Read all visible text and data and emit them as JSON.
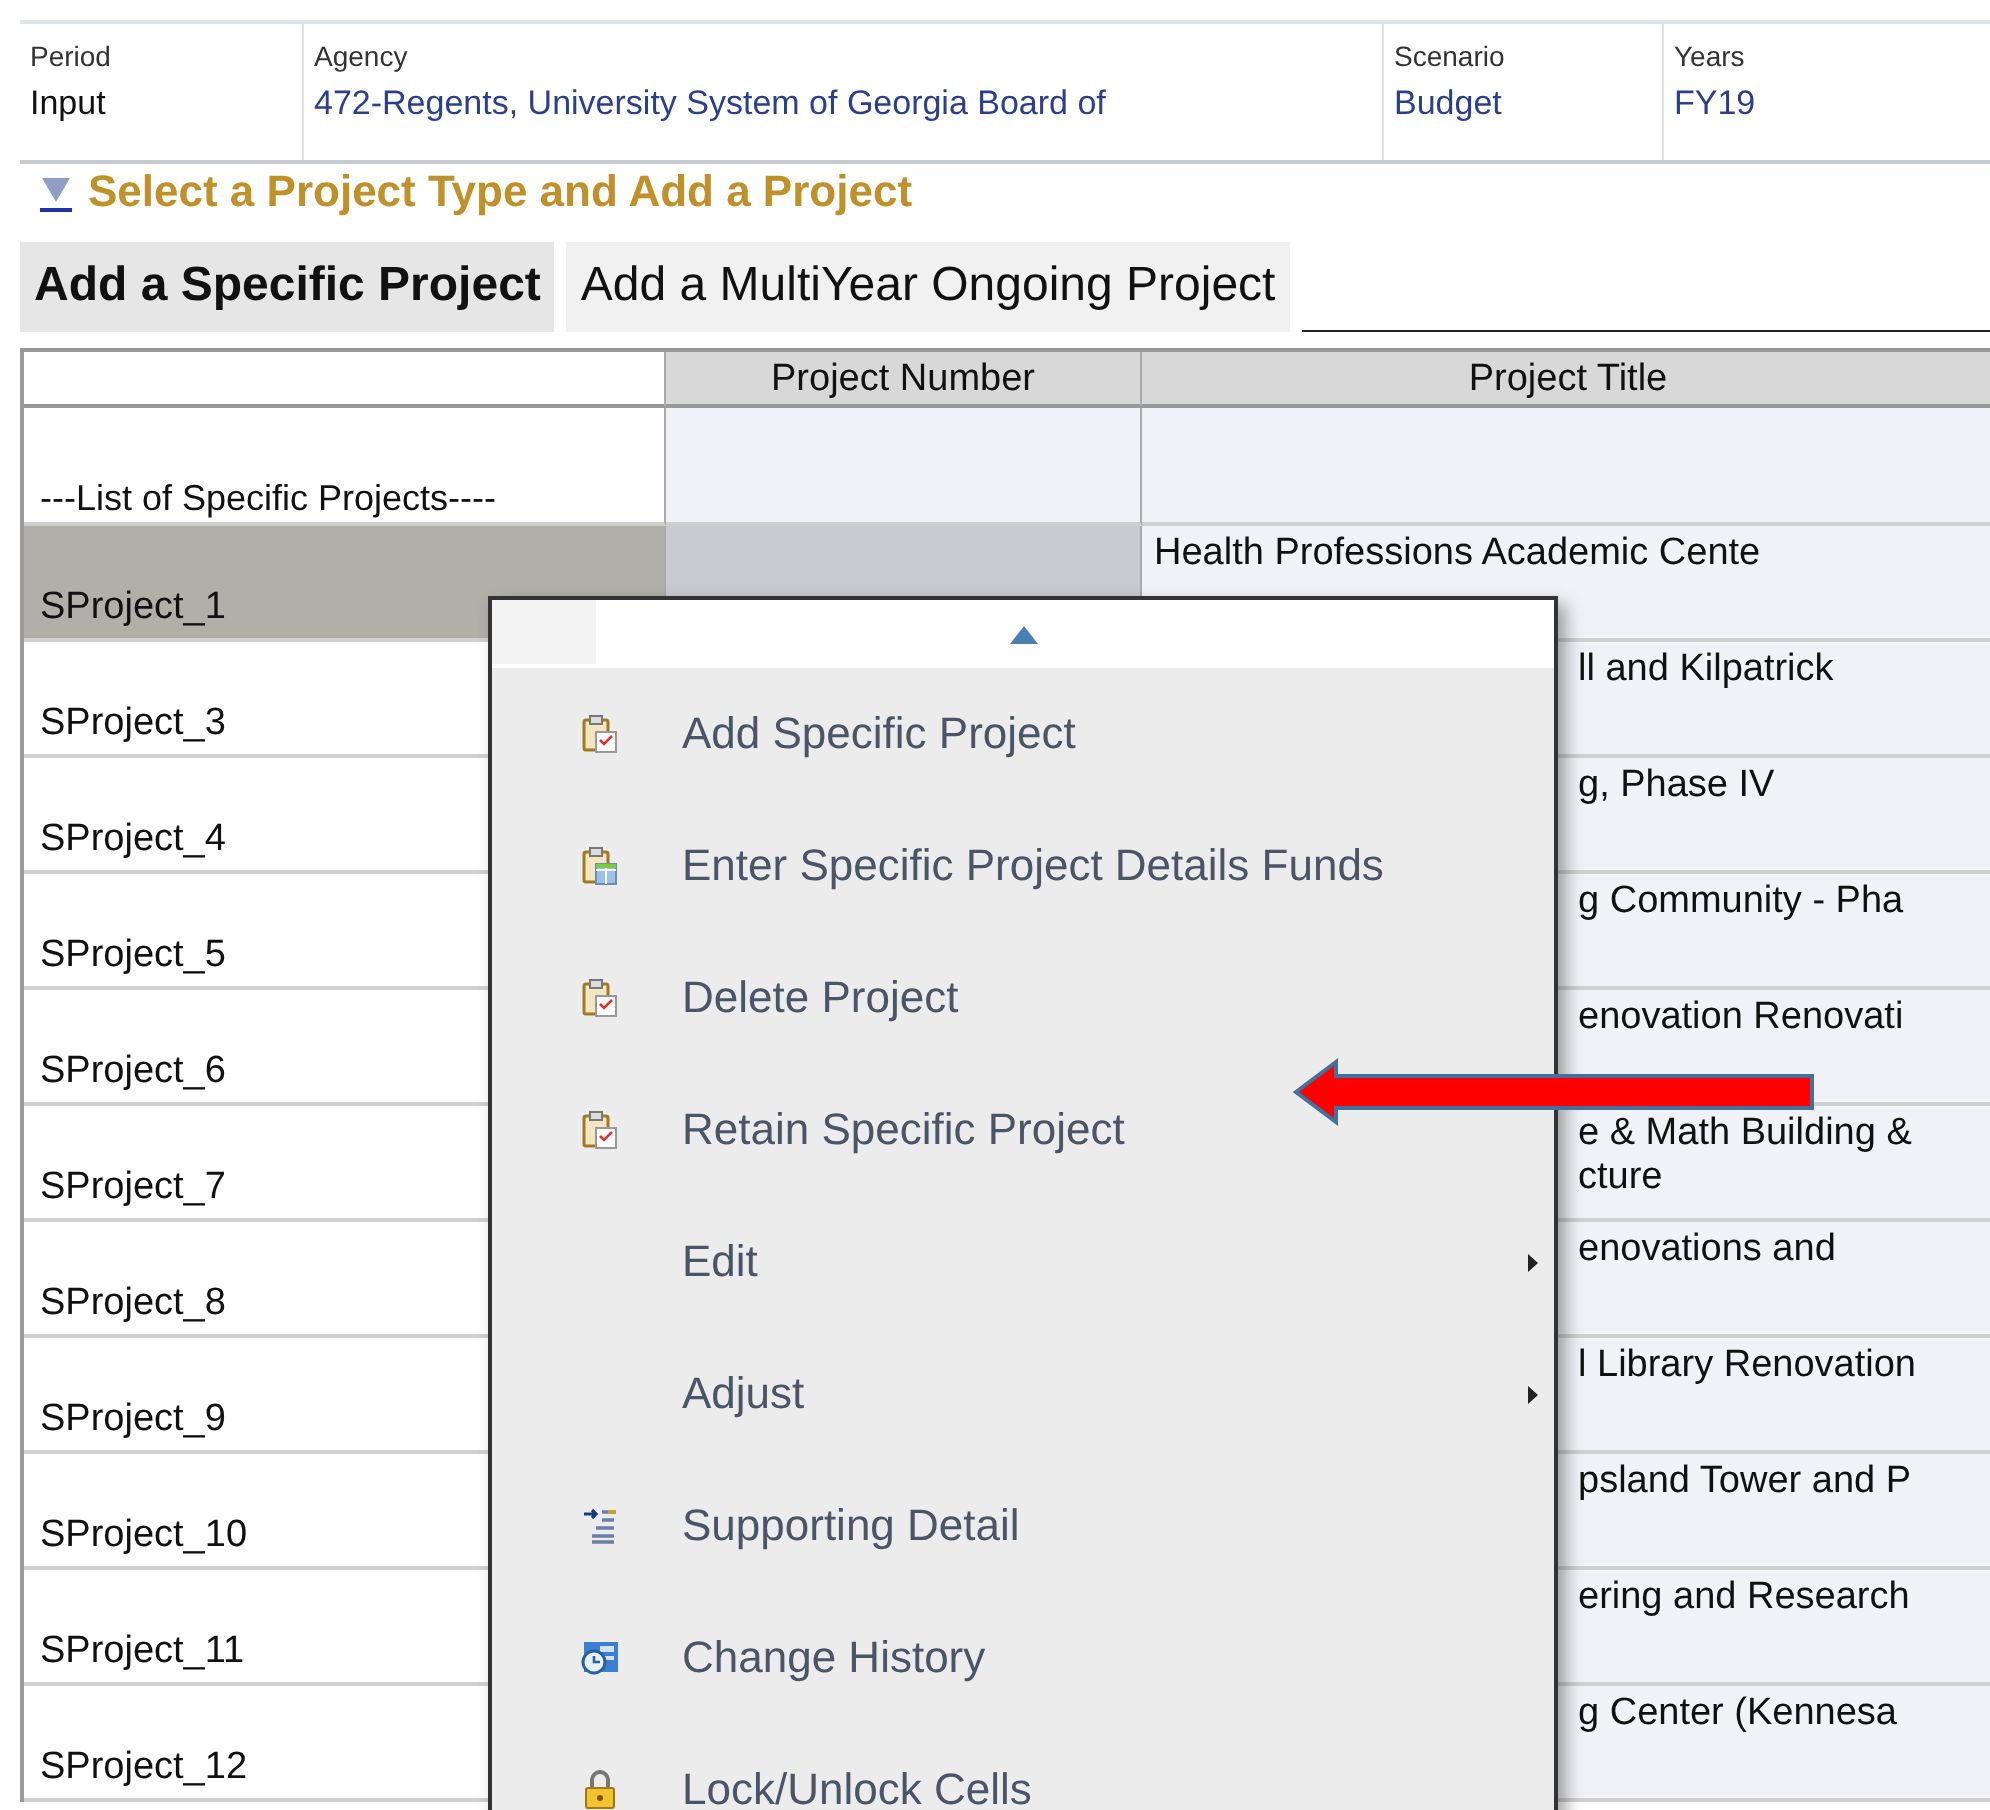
{
  "pov": [
    {
      "label": "Period",
      "value": "Input",
      "kind": "plain"
    },
    {
      "label": "Agency",
      "value": "472-Regents, University System of Georgia Board of",
      "kind": "link"
    },
    {
      "label": "Scenario",
      "value": "Budget",
      "kind": "link"
    },
    {
      "label": "Years",
      "value": "FY19",
      "kind": "link"
    }
  ],
  "section": {
    "title": "Select a Project Type and Add a Project",
    "expanded": true
  },
  "tabs": [
    {
      "label": "Add a Specific Project",
      "selected": true
    },
    {
      "label": "Add a MultiYear Ongoing Project",
      "selected": false
    }
  ],
  "table": {
    "columns": [
      "Project Number",
      "Project Title"
    ],
    "list_label": "---List of Specific Projects----",
    "rows": [
      {
        "name": "SProject_1",
        "title": "Health Professions Academic Cente",
        "selected": true
      },
      {
        "name": "SProject_3",
        "title": "ll and Kilpatrick",
        "selected": false
      },
      {
        "name": "SProject_4",
        "title": "g, Phase IV",
        "selected": false
      },
      {
        "name": "SProject_5",
        "title": "g Community - Pha",
        "selected": false
      },
      {
        "name": "SProject_6",
        "title": "enovation Renovati",
        "selected": false
      },
      {
        "name": "SProject_7",
        "title": "e & Math Building &\ncture",
        "selected": false
      },
      {
        "name": "SProject_8",
        "title": "enovations and",
        "selected": false
      },
      {
        "name": "SProject_9",
        "title": "l Library Renovation",
        "selected": false
      },
      {
        "name": "SProject_10",
        "title": "psland Tower and P",
        "selected": false
      },
      {
        "name": "SProject_11",
        "title": "ering and Research",
        "selected": false
      },
      {
        "name": "SProject_12",
        "title": "g Center (Kennesa",
        "selected": false
      }
    ]
  },
  "context_menu": {
    "items": [
      {
        "label": "Add Specific Project",
        "kind": "clipboard",
        "submenu": false
      },
      {
        "label": "Enter Specific Project Details Funds",
        "kind": "grid",
        "submenu": false
      },
      {
        "label": "Delete Project",
        "kind": "clipboard",
        "submenu": false
      },
      {
        "label": "Retain Specific Project",
        "kind": "clipboard",
        "submenu": false
      },
      {
        "label": "Edit",
        "kind": "plain",
        "submenu": true
      },
      {
        "label": "Adjust",
        "kind": "plain",
        "submenu": true
      },
      {
        "label": "Supporting Detail",
        "kind": "indent",
        "submenu": false
      },
      {
        "label": "Change History",
        "kind": "history",
        "submenu": false
      },
      {
        "label": "Lock/Unlock Cells",
        "kind": "lock",
        "submenu": false
      }
    ]
  }
}
